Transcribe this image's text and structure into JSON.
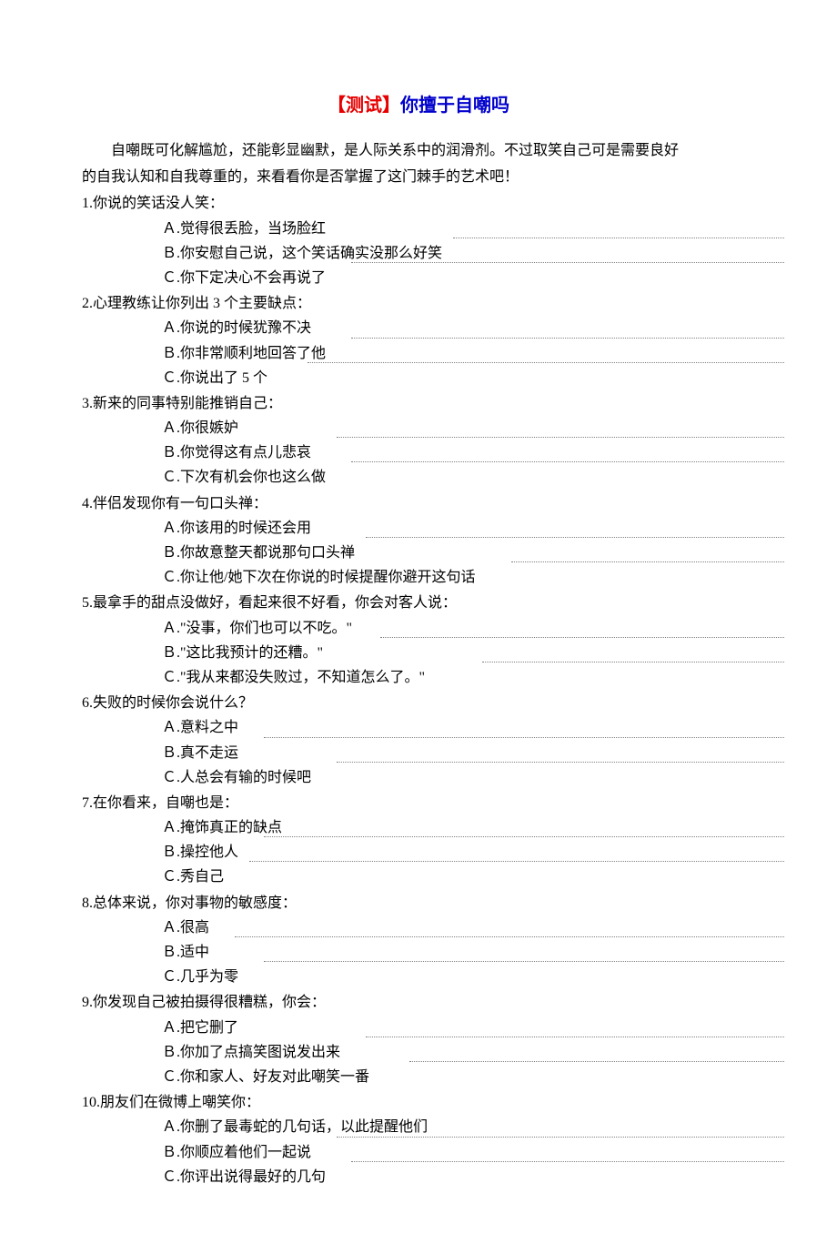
{
  "title": {
    "red": "【测试】",
    "blue": "你擅于自嘲吗"
  },
  "intro_line1": "自嘲既可化解尴尬，还能彰显幽默，是人际关系中的润滑剂。不过取笑自己可是需要良好",
  "intro_line2": "的自我认知和自我尊重的，来看看你是否掌握了这门棘手的艺术吧！",
  "questions": [
    {
      "q": "1.你说的笑话没人笑：",
      "opts": [
        "Ａ.觉得很丢脸，当场脸红",
        "Ｂ.你安慰自己说，这个笑话确实没那么好笑",
        "Ｃ.你下定决心不会再说了"
      ]
    },
    {
      "q": "2.心理教练让你列出 3 个主要缺点：",
      "opts": [
        "Ａ.你说的时候犹豫不决",
        "Ｂ.你非常顺利地回答了他",
        "Ｃ.你说出了 5 个"
      ]
    },
    {
      "q": "3.新来的同事特别能推销自己：",
      "opts": [
        "Ａ.你很嫉妒",
        "Ｂ.你觉得这有点儿悲哀",
        "Ｃ.下次有机会你也这么做"
      ]
    },
    {
      "q": "4.伴侣发现你有一句口头禅：",
      "opts": [
        "Ａ.你该用的时候还会用",
        "Ｂ.你故意整天都说那句口头禅",
        "Ｃ.你让他/她下次在你说的时候提醒你避开这句话"
      ]
    },
    {
      "q": "5.最拿手的甜点没做好，看起来很不好看，你会对客人说：",
      "opts": [
        "Ａ.\"没事，你们也可以不吃。\"",
        "Ｂ.\"这比我预计的还糟。\"",
        "Ｃ.\"我从来都没失败过，不知道怎么了。\""
      ]
    },
    {
      "q": "6.失败的时候你会说什么？",
      "opts": [
        "Ａ.意料之中",
        "Ｂ.真不走运",
        "Ｃ.人总会有输的时候吧"
      ]
    },
    {
      "q": "7.在你看来，自嘲也是：",
      "opts": [
        "Ａ.掩饰真正的缺点",
        "Ｂ.操控他人",
        "Ｃ.秀自己"
      ]
    },
    {
      "q": "8.总体来说，你对事物的敏感度：",
      "opts": [
        "Ａ.很高",
        "Ｂ.适中",
        "Ｃ.几乎为零"
      ]
    },
    {
      "q": "9.你发现自己被拍摄得很糟糕，你会：",
      "opts": [
        "Ａ.把它删了",
        "Ｂ.你加了点搞笑图说发出来",
        "Ｃ.你和家人、好友对此嘲笑一番"
      ]
    },
    {
      "q": "10.朋友们在微博上嘲笑你：",
      "opts": [
        "Ａ.你删了最毒蛇的几句话，以此提醒他们",
        "Ｂ.你顺应着他们一起说",
        "Ｃ.你评出说得最好的几句"
      ]
    }
  ]
}
